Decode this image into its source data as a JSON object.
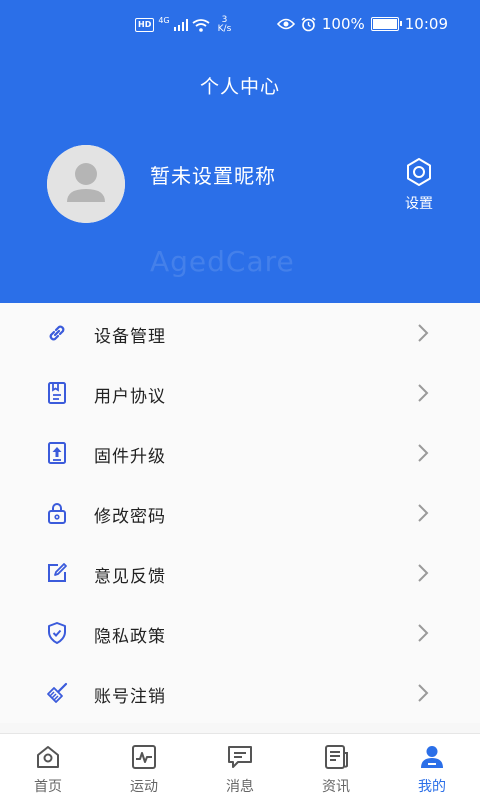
{
  "status_bar": {
    "hd": "HD",
    "network": "4G",
    "speed_value": "3",
    "speed_unit": "K/s",
    "battery": "100%",
    "time": "10:09"
  },
  "header": {
    "title": "个人中心",
    "nickname": "暂未设置昵称",
    "settings_label": "设置",
    "watermark": "AgedCare"
  },
  "menu": {
    "items": [
      {
        "label": "设备管理",
        "icon": "link-icon"
      },
      {
        "label": "用户协议",
        "icon": "document-icon"
      },
      {
        "label": "固件升级",
        "icon": "upgrade-icon"
      },
      {
        "label": "修改密码",
        "icon": "lock-icon"
      },
      {
        "label": "意见反馈",
        "icon": "edit-icon"
      },
      {
        "label": "隐私政策",
        "icon": "shield-icon"
      },
      {
        "label": "账号注销",
        "icon": "broom-icon"
      }
    ]
  },
  "tabbar": {
    "tabs": [
      {
        "label": "首页",
        "icon": "home-icon"
      },
      {
        "label": "运动",
        "icon": "activity-icon"
      },
      {
        "label": "消息",
        "icon": "message-icon"
      },
      {
        "label": "资讯",
        "icon": "news-icon"
      },
      {
        "label": "我的",
        "icon": "profile-icon",
        "active": true
      }
    ]
  },
  "colors": {
    "primary": "#2b6fe8",
    "icon": "#3b5bdb",
    "background": "#f7f7f7"
  }
}
